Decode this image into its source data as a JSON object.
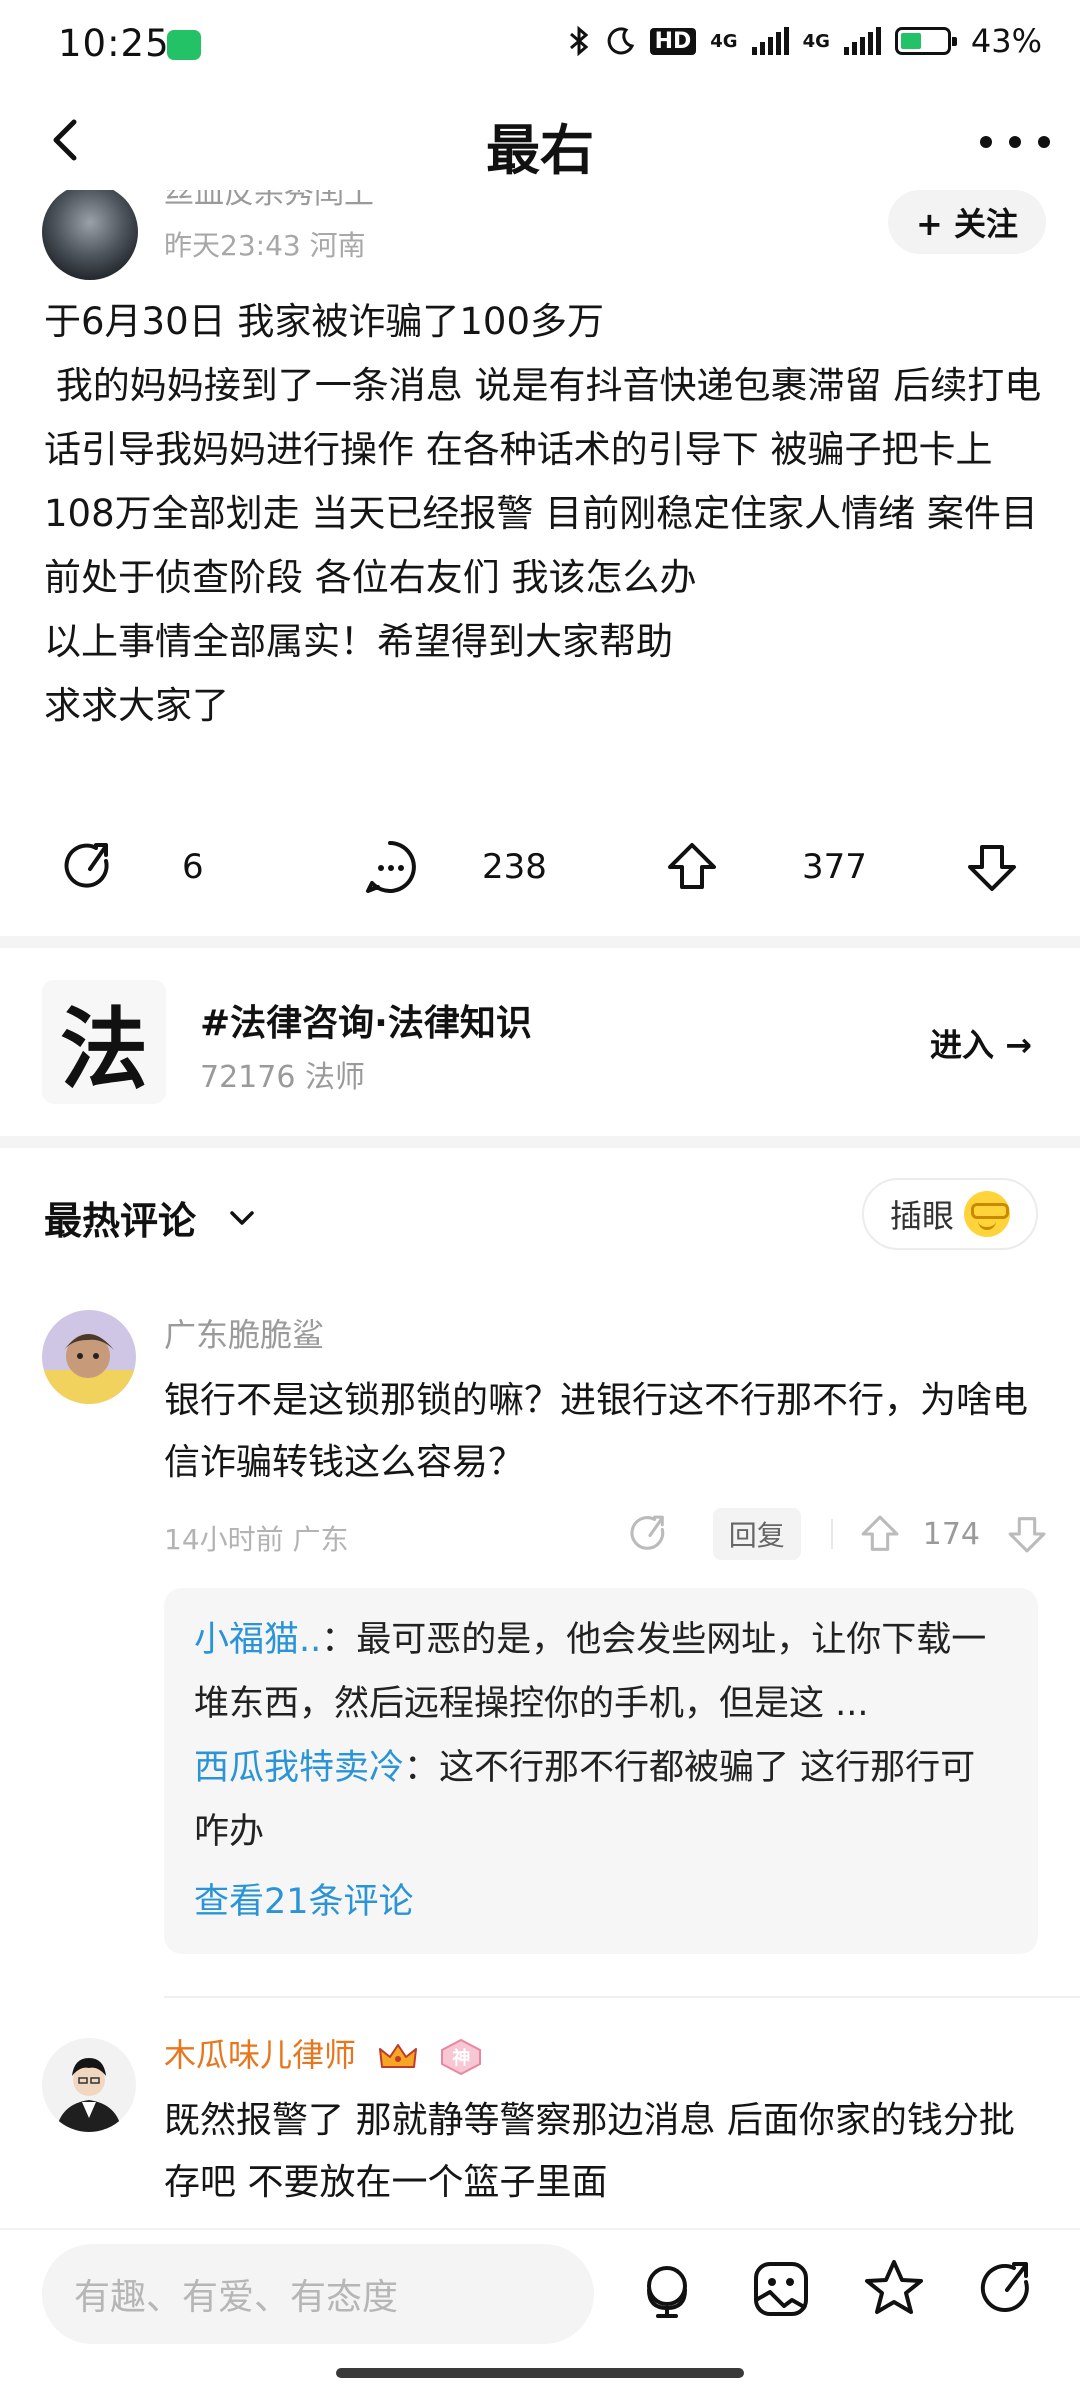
{
  "status_bar": {
    "time": "10:25",
    "hd": "HD",
    "network": "4G",
    "network2": "4G",
    "battery": "43%"
  },
  "nav": {
    "title": "最右"
  },
  "author": {
    "name": "丝血反杀秀闰土",
    "meta": "昨天23:43 河南",
    "follow_label": "+ 关注"
  },
  "post": {
    "body": "于6月30日 我家被诈骗了100多万\n 我的妈妈接到了一条消息 说是有抖音快递包裹滞留 后续打电话引导我妈妈进行操作 在各种话术的引导下 被骗子把卡上108万全部划走 当天已经报警 目前刚稳定住家人情绪 案件目前处于侦查阶段 各位右友们 我该怎么办\n以上事情全部属实！希望得到大家帮助\n求求大家了",
    "share_count": "6",
    "comment_count": "238",
    "like_count": "377"
  },
  "topic": {
    "logo_char": "法",
    "title": "#法律咨询·法律知识",
    "member_count": "72176 法师",
    "enter_label": "进入 →"
  },
  "comments_header": {
    "title": "最热评论",
    "emoji_button_label": "插眼"
  },
  "comments": [
    {
      "user": "广东脆脆鲨",
      "text": "银行不是这锁那锁的嘛？进银行这不行那不行，为啥电信诈骗转钱这么容易？",
      "meta": "14小时前 广东",
      "reply_label": "回复",
      "like_count": "174",
      "replies": [
        {
          "user": "小福猫..",
          "text": "：最可恶的是，他会发些网址，让你下载一堆东西，然后远程操控你的手机，但是这 ..."
        },
        {
          "user": "西瓜我特卖冷",
          "text": "：这不行那不行都被骗了 这行那行可咋办"
        }
      ],
      "more_replies": "查看21条评论"
    },
    {
      "user": "木瓜味儿律师",
      "badge": "神",
      "text": "既然报警了 那就静等警察那边消息 后面你家的钱分批存吧 不要放在一个篮子里面"
    }
  ],
  "bottom_bar": {
    "input_placeholder": "有趣、有爱、有态度"
  },
  "colors": {
    "accent_blue": "#2a94d6",
    "lawyer_orange": "#e8761e",
    "battery_green": "#23c266"
  },
  "icons": [
    "back-icon",
    "more-icon",
    "share-icon",
    "comment-icon",
    "upvote-icon",
    "downvote-icon",
    "chevron-down-icon",
    "voice-icon",
    "sticker-icon",
    "star-icon",
    "share-icon"
  ]
}
